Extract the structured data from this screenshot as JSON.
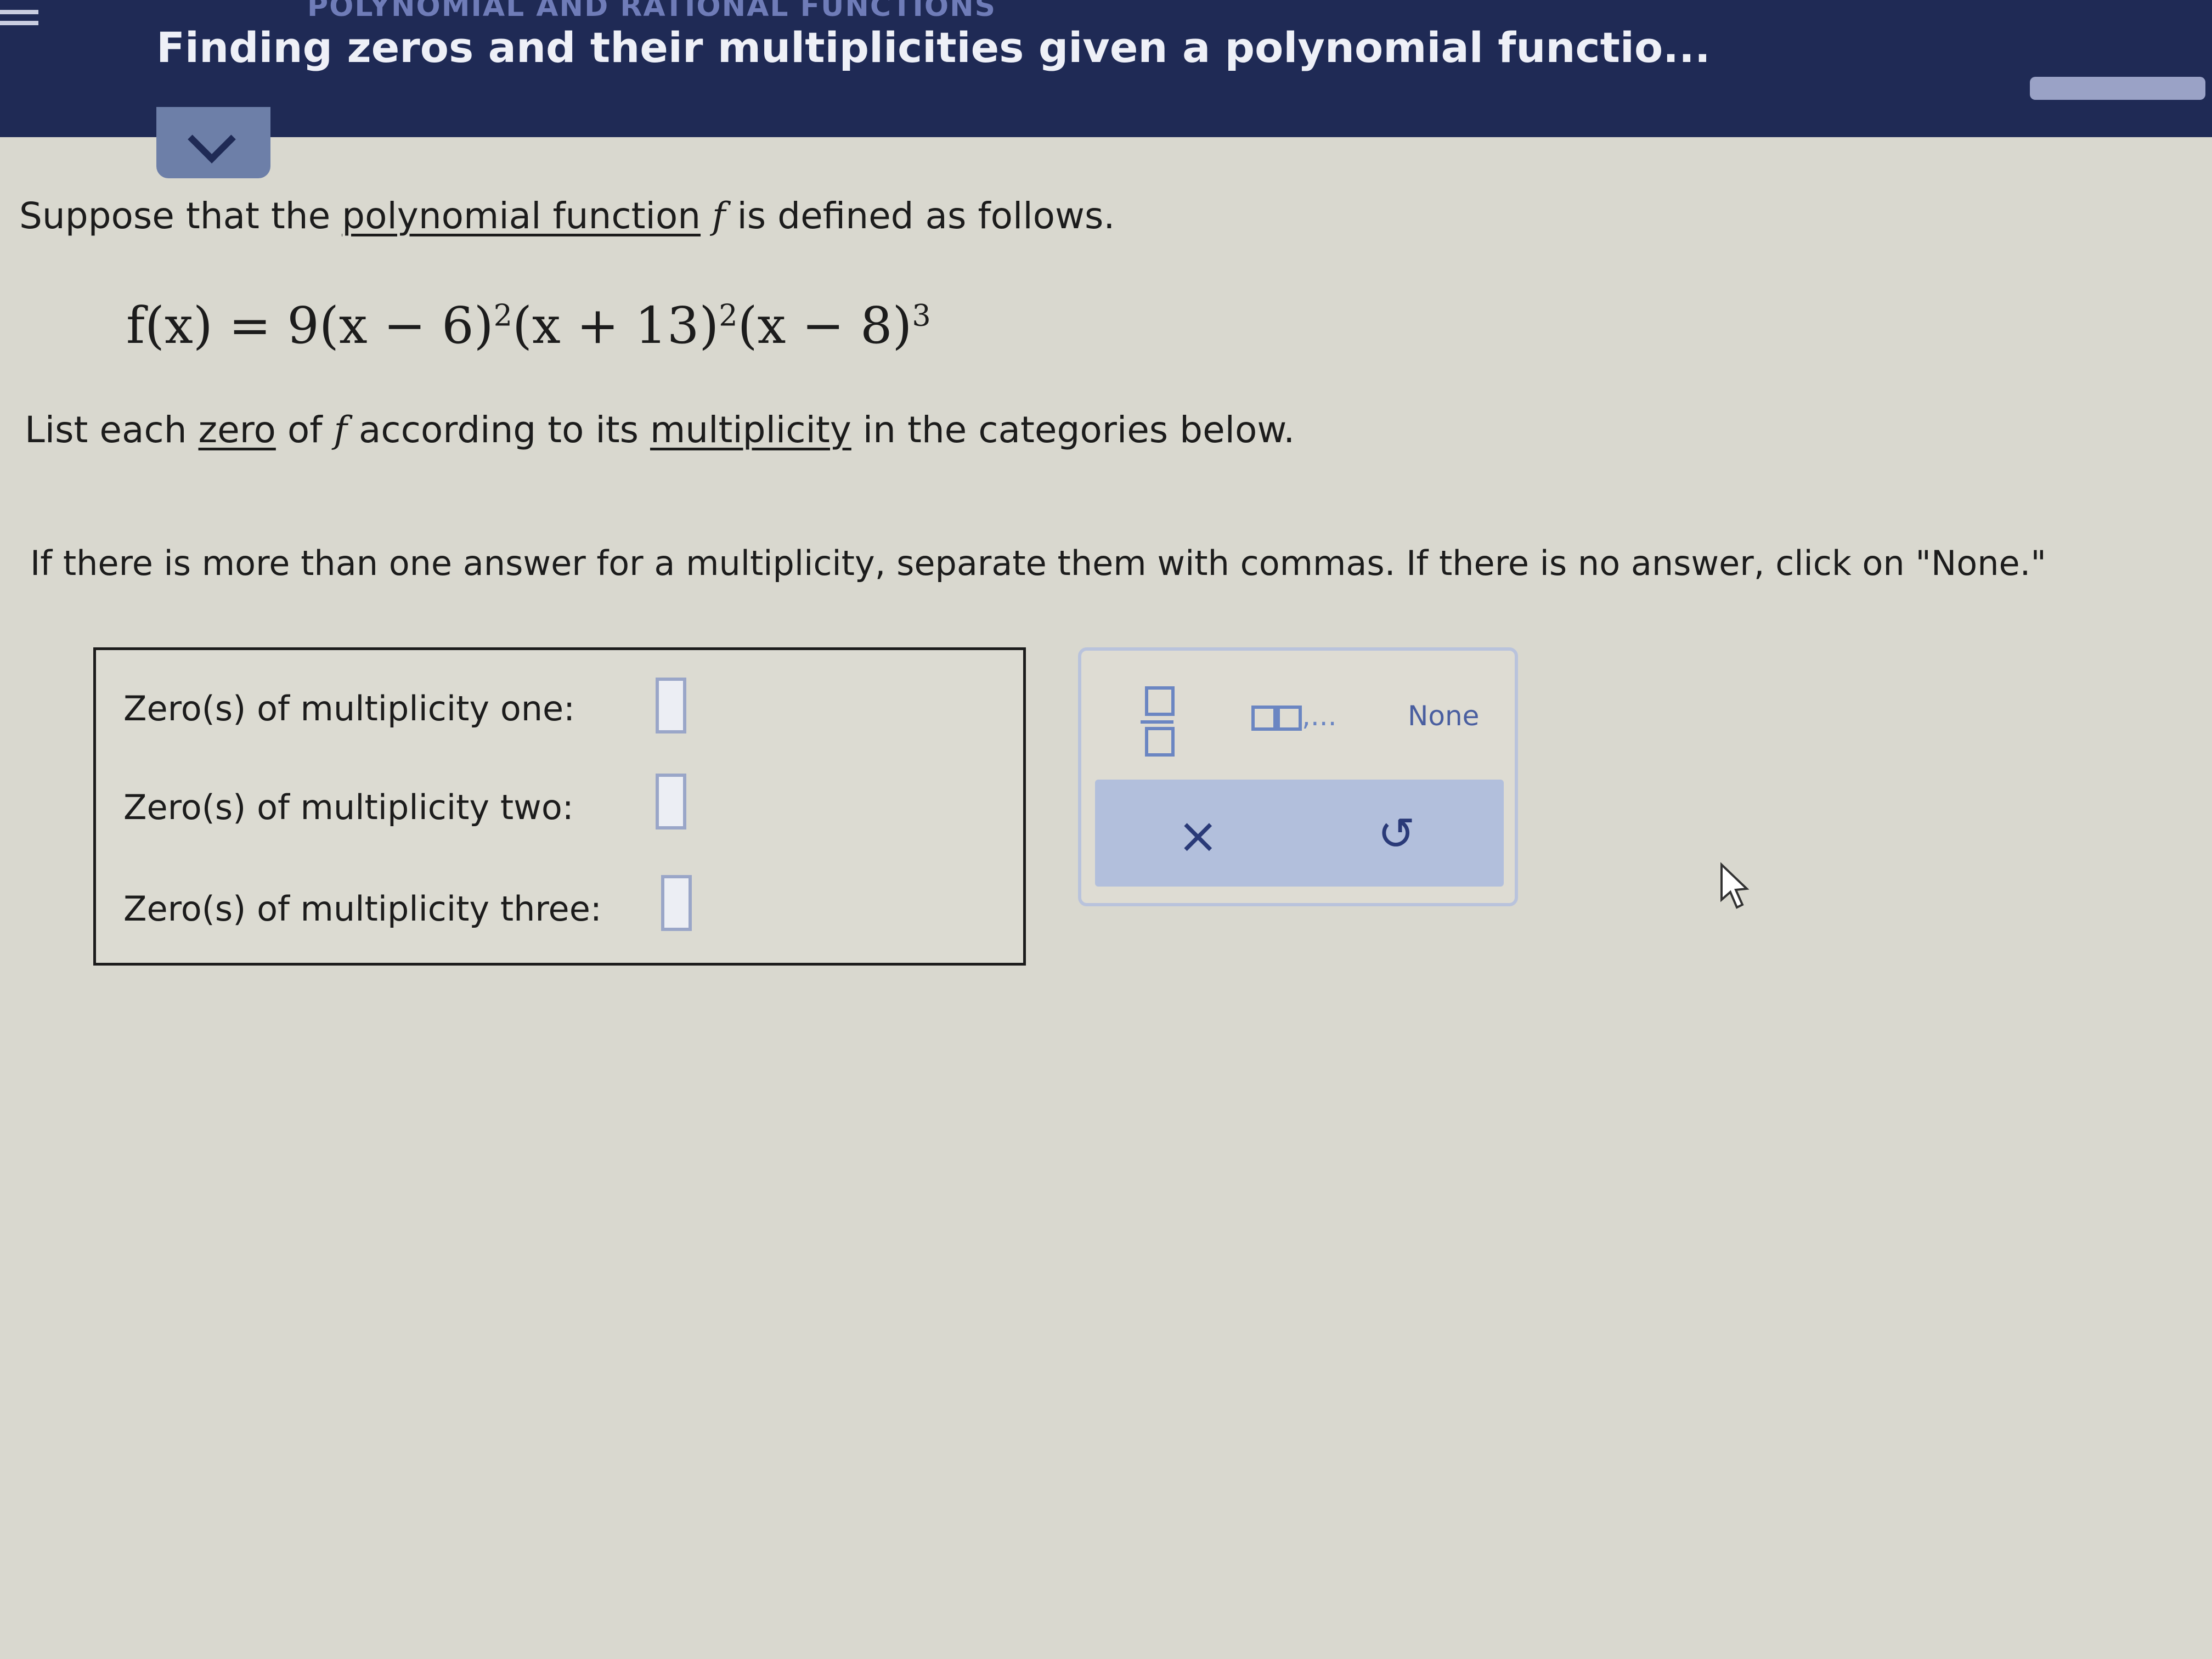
{
  "header": {
    "breadcrumb": "POLYNOMIAL AND RATIONAL FUNCTIONS",
    "title": "Finding zeros and their multiplicities given a polynomial functio..."
  },
  "problem": {
    "intro_before": "Suppose that the",
    "intro_link": "polynomial function",
    "intro_var": "f",
    "intro_after": "is defined as follows.",
    "formula": {
      "lhs": "f(x) = 9(x − 6)",
      "exp1": "2",
      "mid": "(x + 13)",
      "exp2": "2",
      "tail": "(x − 8)",
      "exp3": "3"
    },
    "instr_start": "List each",
    "instr_link_zero": "zero",
    "instr_of": "of",
    "instr_var": "f",
    "instr_mid": "according to its",
    "instr_link_mult": "multiplicity",
    "instr_end": "in the categories below.",
    "note": "If there is more than one answer for a multiplicity, separate them with commas. If there is no answer, click on \"None.\""
  },
  "answers": {
    "one_label": "Zero(s) of multiplicity one:",
    "two_label": "Zero(s) of multiplicity two:",
    "three_label": "Zero(s) of multiplicity three:",
    "one_value": "",
    "two_value": "",
    "three_value": ""
  },
  "keypad": {
    "fraction_icon": "fraction-icon",
    "list_label": ",...",
    "none_label": "None",
    "clear_label": "×",
    "undo_label": "↺"
  },
  "colors": {
    "header_bg": "#1f2a55",
    "accent": "#6b86c2",
    "page_bg": "#d9d8cf"
  }
}
